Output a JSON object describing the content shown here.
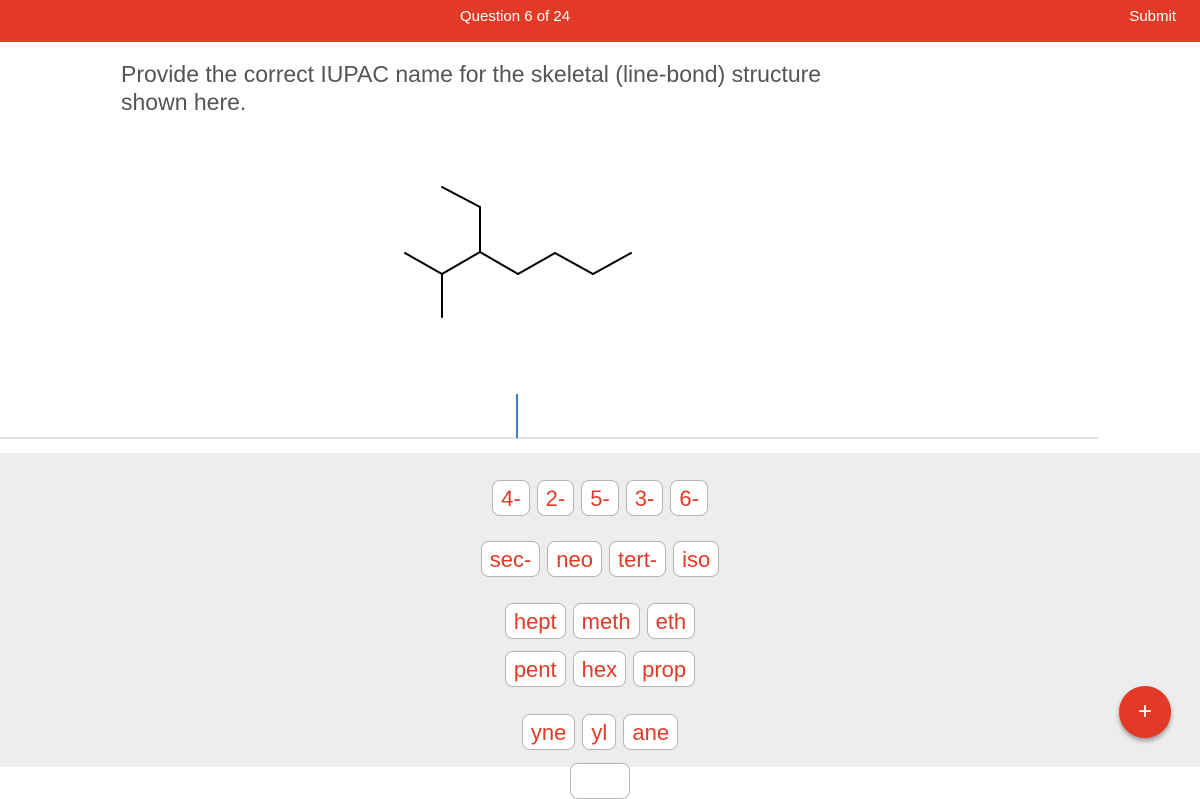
{
  "header": {
    "question_counter": "Question 6 of 24",
    "submit_label": "Submit"
  },
  "question": {
    "prompt": "Provide the correct IUPAC name for the skeletal (line-bond) structure shown here."
  },
  "answer": {
    "value": ""
  },
  "palette": {
    "rows": [
      [
        "4-",
        "2-",
        "5-",
        "3-",
        "6-"
      ],
      [
        "sec-",
        "neo",
        "tert-",
        "iso"
      ],
      [
        "hept",
        "meth",
        "eth"
      ],
      [
        "pent",
        "hex",
        "prop"
      ],
      [
        "yne",
        "yl",
        "ane"
      ],
      [
        ""
      ]
    ]
  },
  "fab": {
    "label": "+"
  },
  "colors": {
    "accent": "#e33a27",
    "caret": "#3a7bd5",
    "palette_bg": "#ededed"
  }
}
